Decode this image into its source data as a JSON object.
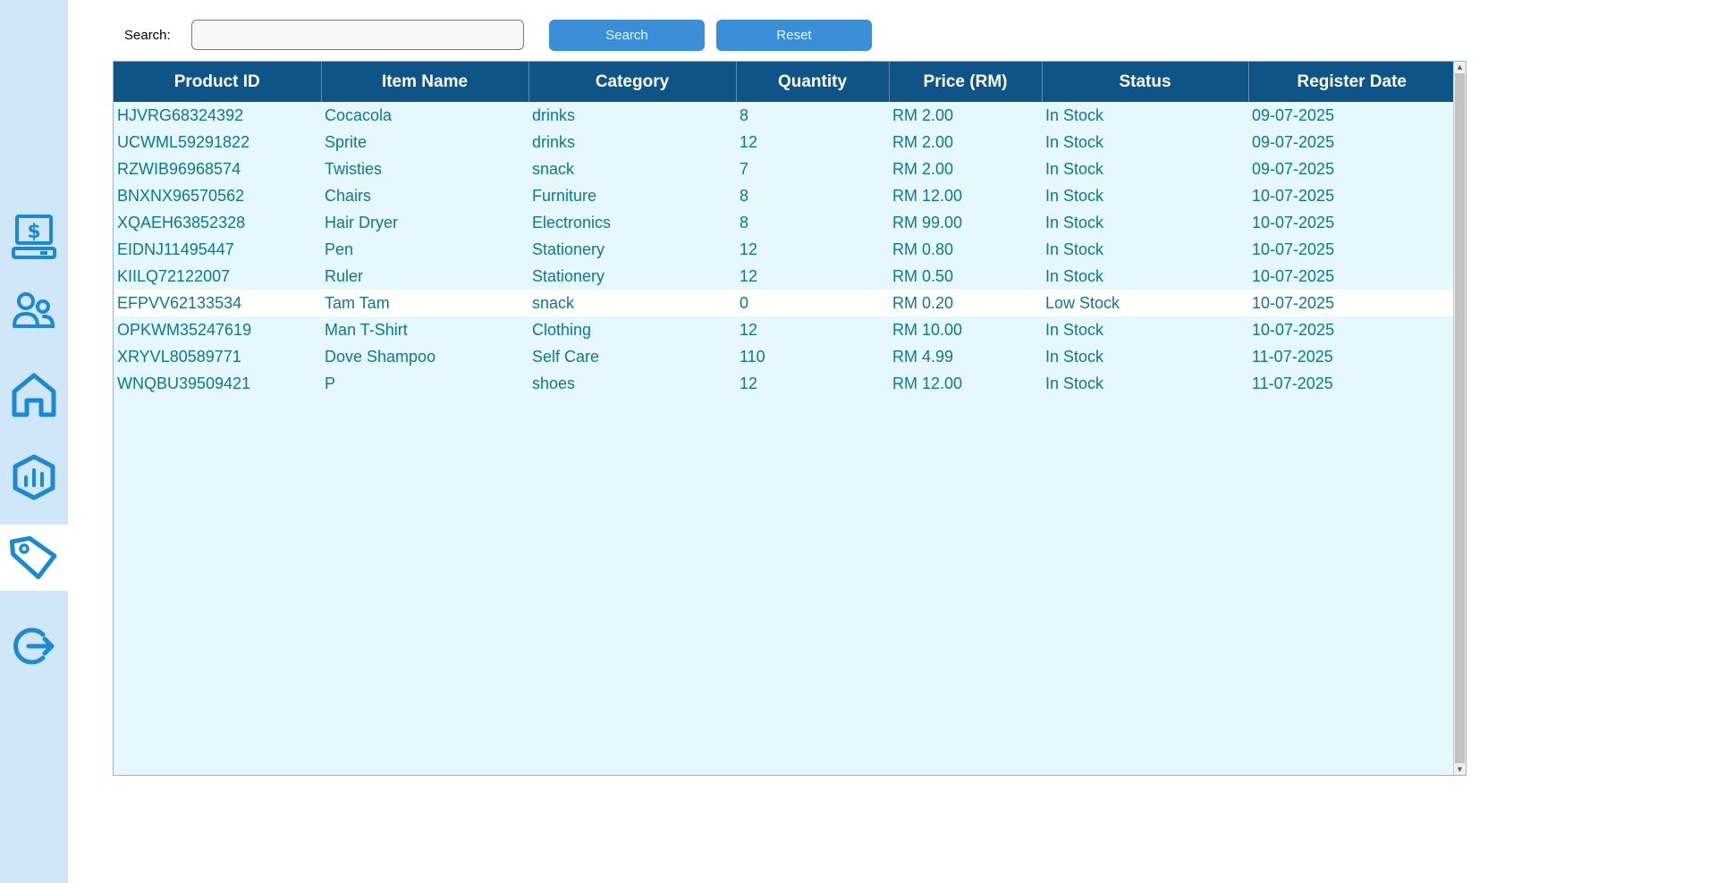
{
  "sidebar": {
    "items": [
      {
        "icon": "cashier-icon"
      },
      {
        "icon": "users-icon"
      },
      {
        "icon": "home-icon"
      },
      {
        "icon": "report-chart-icon"
      },
      {
        "icon": "product-tag-icon",
        "active": true
      },
      {
        "icon": "logout-icon"
      }
    ],
    "accent": "#1a8ad4"
  },
  "search": {
    "label": "Search:",
    "value": "",
    "placeholder": ""
  },
  "buttons": {
    "search_label": "Search",
    "reset_label": "Reset"
  },
  "table": {
    "columns": [
      "Product ID",
      "Item Name",
      "Category",
      "Quantity",
      "Price (RM)",
      "Status",
      "Register Date"
    ],
    "rows": [
      [
        "HJVRG68324392",
        "Cocacola",
        "drinks",
        "8",
        "RM 2.00",
        "In Stock",
        "09-07-2025"
      ],
      [
        "UCWML59291822",
        "Sprite",
        "drinks",
        "12",
        "RM 2.00",
        "In Stock",
        "09-07-2025"
      ],
      [
        "RZWIB96968574",
        "Twisties",
        "snack",
        "7",
        "RM 2.00",
        "In Stock",
        "09-07-2025"
      ],
      [
        "BNXNX96570562",
        "Chairs",
        "Furniture",
        "8",
        "RM 12.00",
        "In Stock",
        "10-07-2025"
      ],
      [
        "XQAEH63852328",
        "Hair Dryer",
        "Electronics",
        "8",
        "RM 99.00",
        "In Stock",
        "10-07-2025"
      ],
      [
        "EIDNJ11495447",
        "Pen",
        "Stationery",
        "12",
        "RM 0.80",
        "In Stock",
        "10-07-2025"
      ],
      [
        "KIILQ72122007",
        "Ruler",
        "Stationery",
        "12",
        "RM 0.50",
        "In Stock",
        "10-07-2025"
      ],
      [
        "EFPVV62133534",
        "Tam Tam",
        "snack",
        "0",
        "RM 0.20",
        "Low Stock",
        "10-07-2025"
      ],
      [
        "OPKWM35247619",
        "Man T-Shirt",
        "Clothing",
        "12",
        "RM 10.00",
        "In Stock",
        "10-07-2025"
      ],
      [
        "XRYVL80589771",
        "Dove Shampoo",
        "Self Care",
        "110",
        "RM 4.99",
        "In Stock",
        "11-07-2025"
      ],
      [
        "WNQBU39509421",
        "P",
        "shoes",
        "12",
        "RM 12.00",
        "In Stock",
        "11-07-2025"
      ]
    ],
    "selected_row": 7,
    "header_color": "#0e5487",
    "text_color": "#0a7c86",
    "background": "#e6f7fd"
  }
}
